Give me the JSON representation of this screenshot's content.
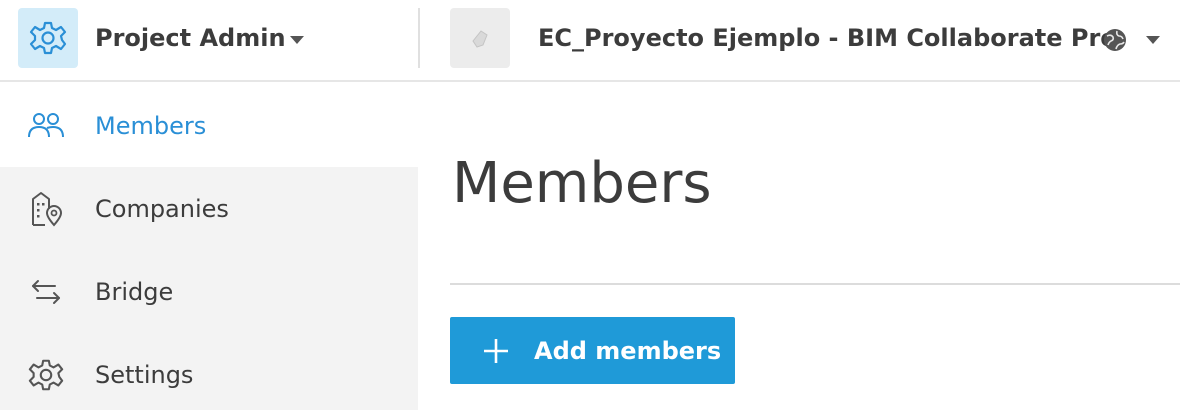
{
  "header": {
    "module_name": "Project Admin",
    "project_name": "EC_Proyecto Ejemplo - BIM Collaborate Pro",
    "module_icon": "gear-icon",
    "project_icon": "project-thumbnail",
    "globe_icon": "globe-icon",
    "caret_icon": "chevron-down-icon"
  },
  "sidebar": {
    "items": [
      {
        "label": "Members",
        "icon": "people-icon",
        "active": true
      },
      {
        "label": "Companies",
        "icon": "company-building-icon",
        "active": false
      },
      {
        "label": "Bridge",
        "icon": "bridge-arrows-icon",
        "active": false
      },
      {
        "label": "Settings",
        "icon": "gear-icon",
        "active": false
      }
    ]
  },
  "main": {
    "title": "Members",
    "add_button_label": "Add members"
  },
  "colors": {
    "accent": "#1f9ad8",
    "active_link": "#2a8fd6",
    "sidebar_bg": "#f3f3f3",
    "module_icon_bg": "#d3ecf9"
  }
}
